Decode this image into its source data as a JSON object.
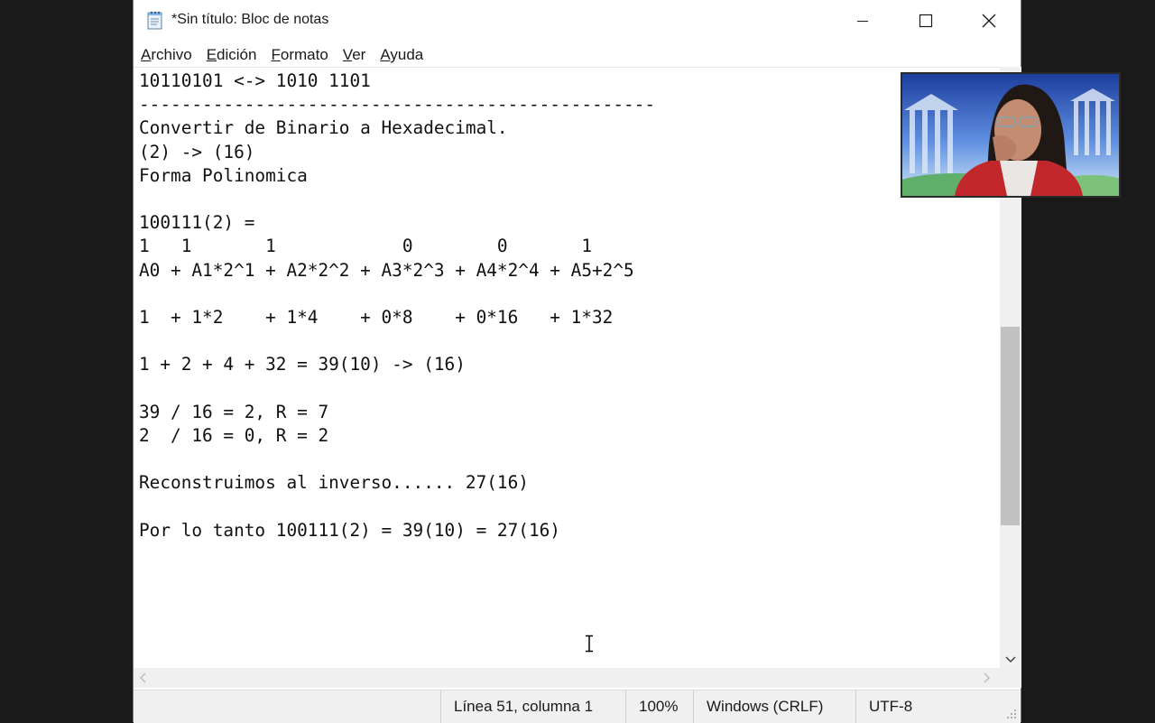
{
  "window": {
    "title": "*Sin título: Bloc de notas"
  },
  "menu": {
    "items": [
      {
        "label": "Archivo",
        "u": "A",
        "rest": "rchivo"
      },
      {
        "label": "Edición",
        "u": "E",
        "rest": "dición"
      },
      {
        "label": "Formato",
        "u": "F",
        "rest": "ormato"
      },
      {
        "label": "Ver",
        "u": "V",
        "rest": "er"
      },
      {
        "label": "Ayuda",
        "u": "A",
        "rest": "yuda"
      }
    ]
  },
  "editor": {
    "lines": [
      "10110101 <-> 1010 1101",
      "-------------------------------------------------",
      "Convertir de Binario a Hexadecimal.",
      "(2) -> (16)",
      "Forma Polinomica",
      "",
      "100111(2) =",
      "1   1       1            0        0       1",
      "A0 + A1*2^1 + A2*2^2 + A3*2^3 + A4*2^4 + A5+2^5",
      "",
      "1  + 1*2    + 1*4    + 0*8    + 0*16   + 1*32",
      "",
      "1 + 2 + 4 + 32 = 39(10) -> (16)",
      "",
      "39 / 16 = 2, R = 7",
      "2  / 16 = 0, R = 2",
      "",
      "Reconstruimos al inverso...... 27(16)",
      "",
      "Por lo tanto 100111(2) = 39(10) = 27(16)"
    ]
  },
  "status": {
    "position": "Línea 51, columna 1",
    "zoom": "100%",
    "line_ending": "Windows (CRLF)",
    "encoding": "UTF-8"
  },
  "icons": {
    "app": "notepad-icon",
    "minimize": "minimize-icon",
    "maximize": "maximize-icon",
    "close": "close-icon"
  },
  "colors": {
    "desktop": "#1a1a1a",
    "scrollbar_track": "#f0f0f0",
    "scrollbar_thumb": "#c1c1c1"
  }
}
